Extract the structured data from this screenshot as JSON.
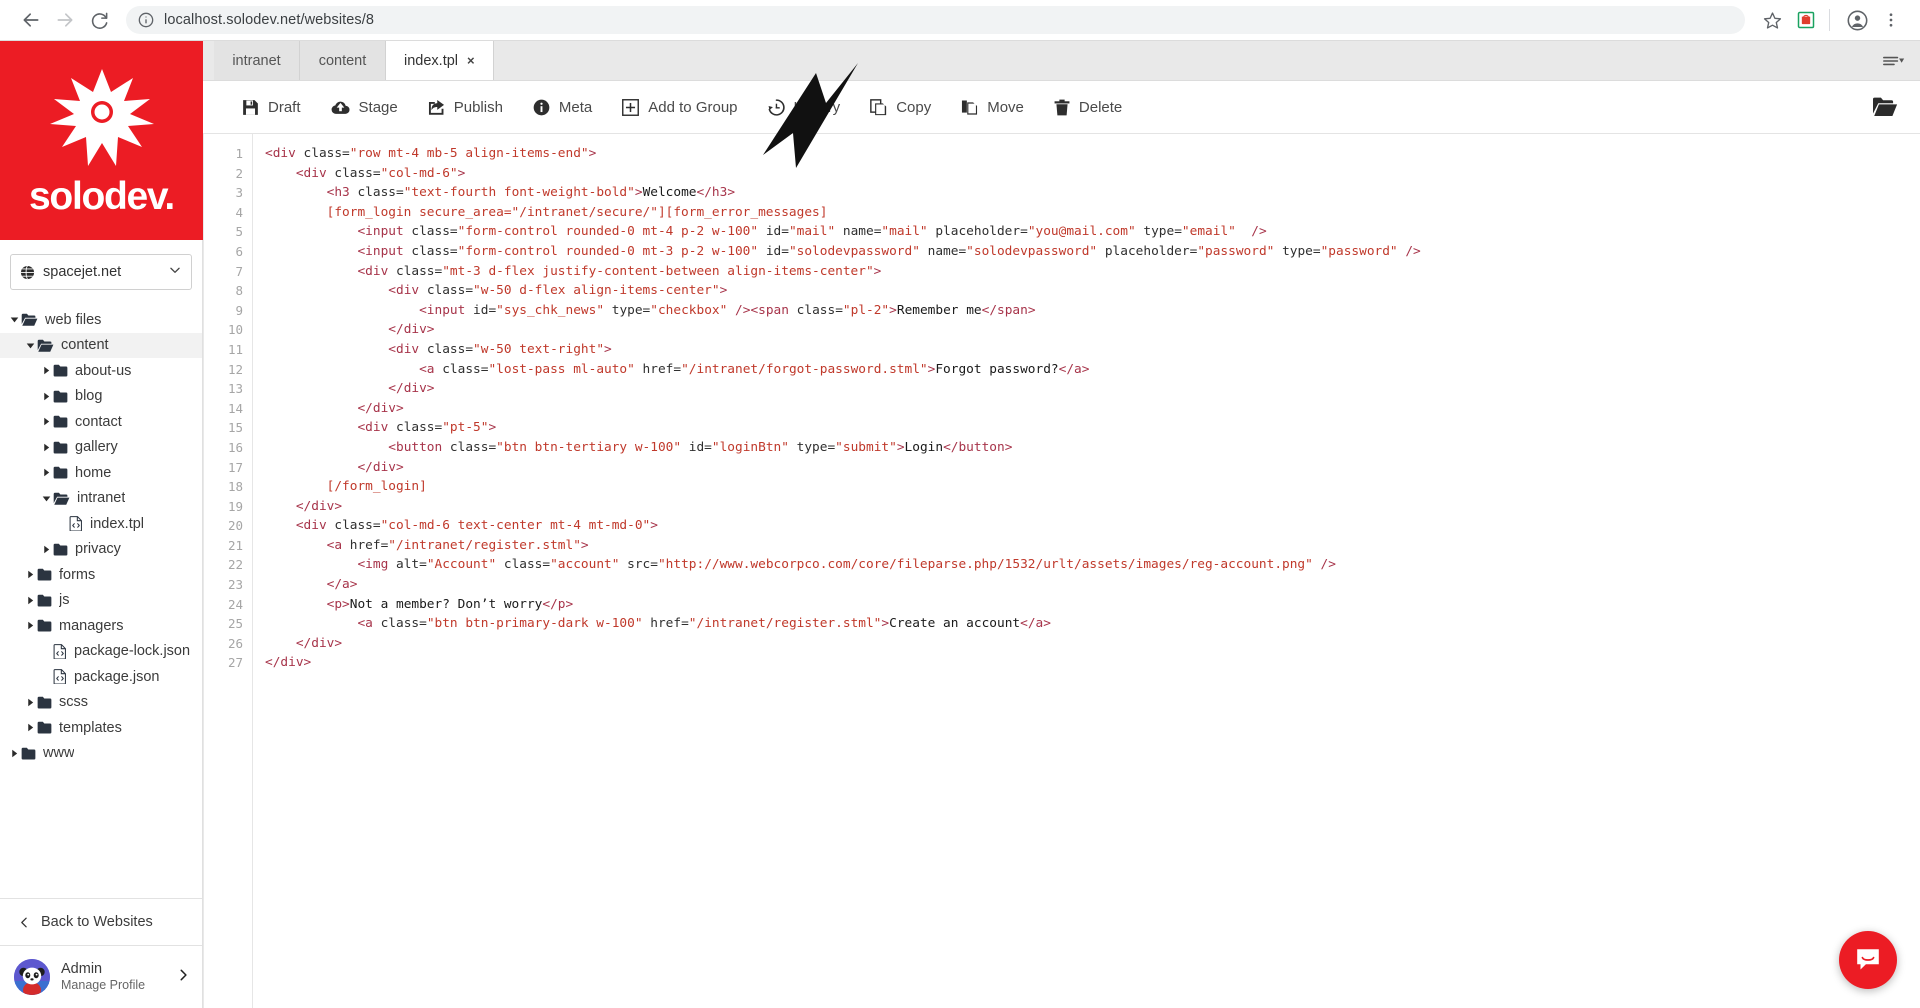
{
  "browser": {
    "url": "localhost.solodev.net/websites/8",
    "back_icon": "back-arrow-icon",
    "forward_icon": "forward-arrow-icon",
    "reload_icon": "reload-icon",
    "info_icon": "site-info-icon",
    "bookmark_icon": "star-icon",
    "extension_icon": "extension-icon",
    "profile_icon": "account-avatar-icon",
    "menu_icon": "three-dot-menu-icon"
  },
  "sidebar": {
    "logo_word": "solodev.",
    "logo_icon": "solodev-star-logo",
    "brand_color": "#ec1c24",
    "site_selector": {
      "name": "spacejet.net",
      "globe_icon": "globe-icon",
      "caret_icon": "chevron-down-icon"
    },
    "tree": [
      {
        "label": "web files",
        "indent": 0,
        "type": "folder-open",
        "expanded": true,
        "active": false
      },
      {
        "label": "content",
        "indent": 1,
        "type": "folder-open",
        "expanded": true,
        "active": true
      },
      {
        "label": "about-us",
        "indent": 2,
        "type": "folder",
        "expanded": false,
        "active": false
      },
      {
        "label": "blog",
        "indent": 2,
        "type": "folder",
        "expanded": false,
        "active": false
      },
      {
        "label": "contact",
        "indent": 2,
        "type": "folder",
        "expanded": false,
        "active": false
      },
      {
        "label": "gallery",
        "indent": 2,
        "type": "folder",
        "expanded": false,
        "active": false
      },
      {
        "label": "home",
        "indent": 2,
        "type": "folder",
        "expanded": false,
        "active": false
      },
      {
        "label": "intranet",
        "indent": 2,
        "type": "folder-open",
        "expanded": true,
        "active": false
      },
      {
        "label": "index.tpl",
        "indent": 3,
        "type": "code-file",
        "expanded": null,
        "active": false
      },
      {
        "label": "privacy",
        "indent": 2,
        "type": "folder",
        "expanded": false,
        "active": false
      },
      {
        "label": "forms",
        "indent": 1,
        "type": "folder",
        "expanded": false,
        "active": false
      },
      {
        "label": "js",
        "indent": 1,
        "type": "folder",
        "expanded": false,
        "active": false
      },
      {
        "label": "managers",
        "indent": 1,
        "type": "folder",
        "expanded": false,
        "active": false
      },
      {
        "label": "package-lock.json",
        "indent": 2,
        "type": "code-file",
        "expanded": null,
        "active": false
      },
      {
        "label": "package.json",
        "indent": 2,
        "type": "code-file",
        "expanded": null,
        "active": false
      },
      {
        "label": "scss",
        "indent": 1,
        "type": "folder",
        "expanded": false,
        "active": false
      },
      {
        "label": "templates",
        "indent": 1,
        "type": "folder",
        "expanded": false,
        "active": false
      },
      {
        "label": "www",
        "indent": 0,
        "type": "folder",
        "expanded": false,
        "active": false
      }
    ],
    "back_to_websites": "Back to Websites",
    "back_icon": "chevron-left-icon",
    "profile": {
      "name": "Admin",
      "subtitle": "Manage Profile",
      "avatar_icon": "panda-avatar",
      "caret_icon": "chevron-right-icon"
    }
  },
  "tabs": {
    "items": [
      {
        "label": "intranet",
        "active": false,
        "closable": false
      },
      {
        "label": "content",
        "active": false,
        "closable": false
      },
      {
        "label": "index.tpl",
        "active": true,
        "closable": true,
        "close_glyph": "×"
      }
    ],
    "menu_icon": "tab-list-menu-icon"
  },
  "toolbar": {
    "buttons": [
      {
        "label": "Draft",
        "icon": "save-disk-icon"
      },
      {
        "label": "Stage",
        "icon": "cloud-upload-icon"
      },
      {
        "label": "Publish",
        "icon": "share-export-icon"
      },
      {
        "label": "Meta",
        "icon": "info-circle-icon"
      },
      {
        "label": "Add to Group",
        "icon": "plus-square-icon"
      },
      {
        "label": "History",
        "icon": "history-clock-icon"
      },
      {
        "label": "Copy",
        "icon": "copy-pages-icon"
      },
      {
        "label": "Move",
        "icon": "move-pages-icon"
      },
      {
        "label": "Delete",
        "icon": "trash-icon"
      }
    ],
    "open_folder_icon": "open-folder-icon"
  },
  "editor": {
    "line_count": 27,
    "lines": [
      [
        [
          "tg",
          "<div "
        ],
        [
          "at",
          "class="
        ],
        [
          "vl",
          "\"row mt-4 mb-5 align-items-end\""
        ],
        [
          "tg",
          ">"
        ]
      ],
      [
        [
          "tx",
          "    "
        ],
        [
          "tg",
          "<div "
        ],
        [
          "at",
          "class="
        ],
        [
          "vl",
          "\"col-md-6\""
        ],
        [
          "tg",
          ">"
        ]
      ],
      [
        [
          "tx",
          "        "
        ],
        [
          "tg",
          "<h3 "
        ],
        [
          "at",
          "class="
        ],
        [
          "vl",
          "\"text-fourth font-weight-bold\""
        ],
        [
          "tg",
          ">"
        ],
        [
          "tx",
          "Welcome"
        ],
        [
          "tg",
          "</h3>"
        ]
      ],
      [
        [
          "tx",
          "        "
        ],
        [
          "sc",
          "[form_login secure_area="
        ],
        [
          "vl",
          "\"/intranet/secure/\""
        ],
        [
          "sc",
          "][form_error_messages]"
        ]
      ],
      [
        [
          "tx",
          "            "
        ],
        [
          "tg",
          "<input "
        ],
        [
          "at",
          "class="
        ],
        [
          "vl",
          "\"form-control rounded-0 mt-4 p-2 w-100\""
        ],
        [
          "at",
          " id="
        ],
        [
          "vl",
          "\"mail\""
        ],
        [
          "at",
          " name="
        ],
        [
          "vl",
          "\"mail\""
        ],
        [
          "at",
          " placeholder="
        ],
        [
          "vl",
          "\"you@mail.com\""
        ],
        [
          "at",
          " type="
        ],
        [
          "vl",
          "\"email\""
        ],
        [
          "tg",
          "  />"
        ]
      ],
      [
        [
          "tx",
          "            "
        ],
        [
          "tg",
          "<input "
        ],
        [
          "at",
          "class="
        ],
        [
          "vl",
          "\"form-control rounded-0 mt-3 p-2 w-100\""
        ],
        [
          "at",
          " id="
        ],
        [
          "vl",
          "\"solodevpassword\""
        ],
        [
          "at",
          " name="
        ],
        [
          "vl",
          "\"solodevpassword\""
        ],
        [
          "at",
          " placeholder="
        ],
        [
          "vl",
          "\"password\""
        ],
        [
          "at",
          " type="
        ],
        [
          "vl",
          "\"password\""
        ],
        [
          "tg",
          " />"
        ]
      ],
      [
        [
          "tx",
          "            "
        ],
        [
          "tg",
          "<div "
        ],
        [
          "at",
          "class="
        ],
        [
          "vl",
          "\"mt-3 d-flex justify-content-between align-items-center\""
        ],
        [
          "tg",
          ">"
        ]
      ],
      [
        [
          "tx",
          "                "
        ],
        [
          "tg",
          "<div "
        ],
        [
          "at",
          "class="
        ],
        [
          "vl",
          "\"w-50 d-flex align-items-center\""
        ],
        [
          "tg",
          ">"
        ]
      ],
      [
        [
          "tx",
          "                    "
        ],
        [
          "tg",
          "<input "
        ],
        [
          "at",
          "id="
        ],
        [
          "vl",
          "\"sys_chk_news\""
        ],
        [
          "at",
          " type="
        ],
        [
          "vl",
          "\"checkbox\""
        ],
        [
          "tg",
          " />"
        ],
        [
          "tg",
          "<span "
        ],
        [
          "at",
          "class="
        ],
        [
          "vl",
          "\"pl-2\""
        ],
        [
          "tg",
          ">"
        ],
        [
          "tx",
          "Remember me"
        ],
        [
          "tg",
          "</span>"
        ]
      ],
      [
        [
          "tx",
          "                "
        ],
        [
          "tg",
          "</div>"
        ]
      ],
      [
        [
          "tx",
          "                "
        ],
        [
          "tg",
          "<div "
        ],
        [
          "at",
          "class="
        ],
        [
          "vl",
          "\"w-50 text-right\""
        ],
        [
          "tg",
          ">"
        ]
      ],
      [
        [
          "tx",
          "                    "
        ],
        [
          "tg",
          "<a "
        ],
        [
          "at",
          "class="
        ],
        [
          "vl",
          "\"lost-pass ml-auto\""
        ],
        [
          "at",
          " href="
        ],
        [
          "vl",
          "\"/intranet/forgot-password.stml\""
        ],
        [
          "tg",
          ">"
        ],
        [
          "tx",
          "Forgot password?"
        ],
        [
          "tg",
          "</a>"
        ]
      ],
      [
        [
          "tx",
          "                "
        ],
        [
          "tg",
          "</div>"
        ]
      ],
      [
        [
          "tx",
          "            "
        ],
        [
          "tg",
          "</div>"
        ]
      ],
      [
        [
          "tx",
          "            "
        ],
        [
          "tg",
          "<div "
        ],
        [
          "at",
          "class="
        ],
        [
          "vl",
          "\"pt-5\""
        ],
        [
          "tg",
          ">"
        ]
      ],
      [
        [
          "tx",
          "                "
        ],
        [
          "tg",
          "<button "
        ],
        [
          "at",
          "class="
        ],
        [
          "vl",
          "\"btn btn-tertiary w-100\""
        ],
        [
          "at",
          " id="
        ],
        [
          "vl",
          "\"loginBtn\""
        ],
        [
          "at",
          " type="
        ],
        [
          "vl",
          "\"submit\""
        ],
        [
          "tg",
          ">"
        ],
        [
          "tx",
          "Login"
        ],
        [
          "tg",
          "</button>"
        ]
      ],
      [
        [
          "tx",
          "            "
        ],
        [
          "tg",
          "</div>"
        ]
      ],
      [
        [
          "tx",
          "        "
        ],
        [
          "sc",
          "[/form_login]"
        ]
      ],
      [
        [
          "tx",
          "    "
        ],
        [
          "tg",
          "</div>"
        ]
      ],
      [
        [
          "tx",
          "    "
        ],
        [
          "tg",
          "<div "
        ],
        [
          "at",
          "class="
        ],
        [
          "vl",
          "\"col-md-6 text-center mt-4 mt-md-0\""
        ],
        [
          "tg",
          ">"
        ]
      ],
      [
        [
          "tx",
          "        "
        ],
        [
          "tg",
          "<a "
        ],
        [
          "at",
          "href="
        ],
        [
          "vl",
          "\"/intranet/register.stml\""
        ],
        [
          "tg",
          ">"
        ]
      ],
      [
        [
          "tx",
          "            "
        ],
        [
          "tg",
          "<img "
        ],
        [
          "at",
          "alt="
        ],
        [
          "vl",
          "\"Account\""
        ],
        [
          "at",
          " class="
        ],
        [
          "vl",
          "\"account\""
        ],
        [
          "at",
          " src="
        ],
        [
          "vl",
          "\"http://www.webcorpco.com/core/fileparse.php/1532/urlt/assets/images/reg-account.png\""
        ],
        [
          "tg",
          " />"
        ]
      ],
      [
        [
          "tx",
          "        "
        ],
        [
          "tg",
          "</a>"
        ]
      ],
      [
        [
          "tx",
          "        "
        ],
        [
          "tg",
          "<p>"
        ],
        [
          "tx",
          "Not a member? Don’t worry"
        ],
        [
          "tg",
          "</p>"
        ]
      ],
      [
        [
          "tx",
          "            "
        ],
        [
          "tg",
          "<a "
        ],
        [
          "at",
          "class="
        ],
        [
          "vl",
          "\"btn btn-primary-dark w-100\""
        ],
        [
          "at",
          " href="
        ],
        [
          "vl",
          "\"/intranet/register.stml\""
        ],
        [
          "tg",
          ">"
        ],
        [
          "tx",
          "Create an account"
        ],
        [
          "tg",
          "</a>"
        ]
      ],
      [
        [
          "tx",
          "    "
        ],
        [
          "tg",
          "</div>"
        ]
      ],
      [
        [
          "tg",
          "</div>"
        ]
      ]
    ]
  },
  "overlays": {
    "pointer_icon": "large-arrow-cursor",
    "intercom": {
      "icon": "chat-bubble-icon",
      "color": "#ec1c24"
    }
  }
}
